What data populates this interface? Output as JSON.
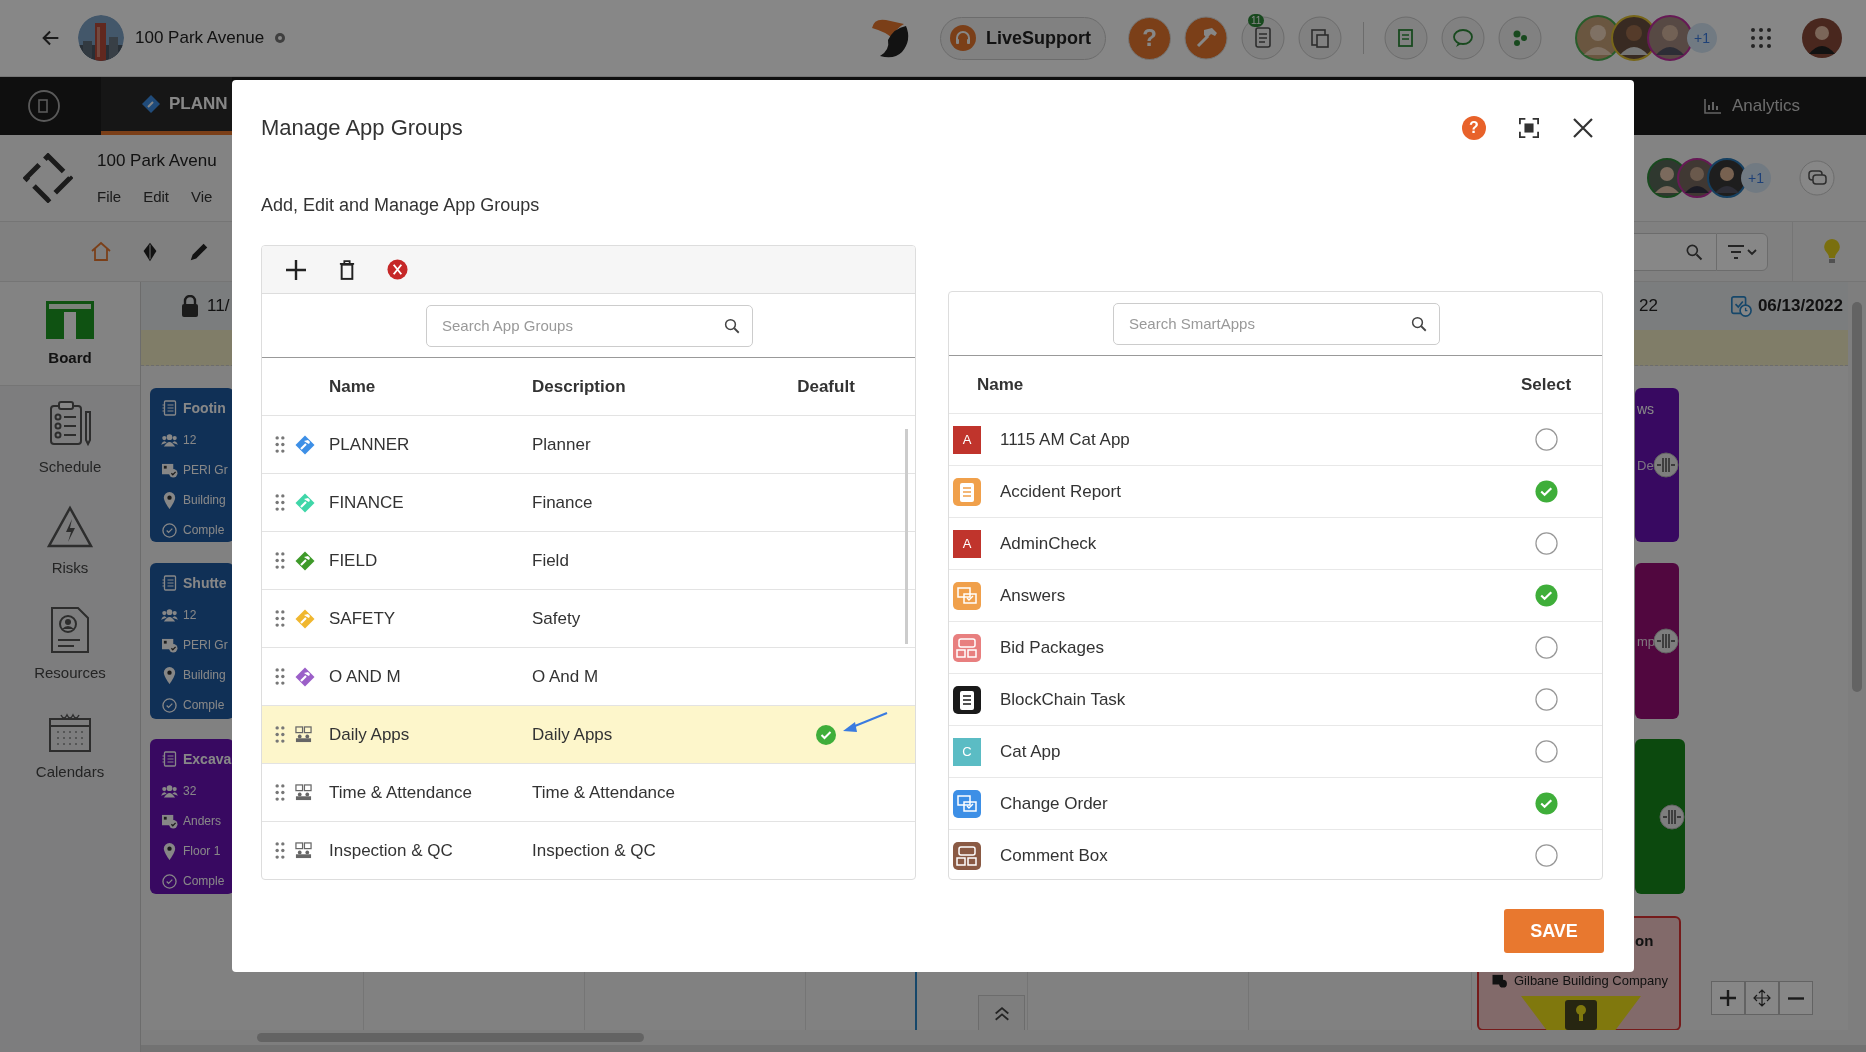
{
  "top_bar": {
    "project": "100 Park Avenue",
    "live_support": "LiveSupport",
    "help_label": "?",
    "notification_count": "11",
    "members_more": "+1"
  },
  "nav": {
    "tab": "PLANN",
    "analytics": "Analytics"
  },
  "project_header": {
    "title": "100 Park Avenu",
    "menu": [
      "File",
      "Edit",
      "Vie"
    ],
    "members_more": "+1"
  },
  "sidebar": {
    "items": [
      {
        "label": "Board",
        "selected": true
      },
      {
        "label": "Schedule",
        "selected": false
      },
      {
        "label": "Risks",
        "selected": false
      },
      {
        "label": "Resources",
        "selected": false
      },
      {
        "label": "Calendars",
        "selected": false
      }
    ]
  },
  "board": {
    "start_date": "11/",
    "end_date_part": "22",
    "end_date": "06/13/2022",
    "cards": [
      {
        "kind": "detail",
        "title": "Footin",
        "fields": [
          "12",
          "PERI Gr",
          "Building",
          "Comple"
        ]
      },
      {
        "kind": "detail",
        "title": "Shutte",
        "fields": [
          "12",
          "PERI Gr",
          "Building",
          "Comple"
        ]
      },
      {
        "kind": "detail",
        "title": "Excava",
        "fields": [
          "32",
          "Anders",
          "Floor 1",
          "Comple"
        ]
      },
      {
        "kind": "edge",
        "title": "ws",
        "detail": "De"
      },
      {
        "kind": "edge",
        "detail": "mp"
      },
      {
        "kind": "edge"
      },
      {
        "kind": "milestone",
        "title": "on",
        "company": "Gilbane Building Company"
      }
    ]
  },
  "dialog": {
    "title": "Manage App Groups",
    "help_label": "?",
    "subtitle": "Add, Edit and Manage App Groups",
    "groups": {
      "search": {
        "placeholder": "Search App Groups"
      },
      "columns": [
        "Name",
        "Description",
        "Deafult"
      ],
      "rows": [
        {
          "name": "PLANNER",
          "description": "Planner",
          "kind": "tag",
          "color": "#3d8fe6",
          "default": false,
          "selected": false
        },
        {
          "name": "FINANCE",
          "description": "Finance",
          "kind": "tag",
          "color": "#3fd6a8",
          "default": false,
          "selected": false
        },
        {
          "name": "FIELD",
          "description": "Field",
          "kind": "tag",
          "color": "#3e9a2a",
          "default": false,
          "selected": false
        },
        {
          "name": "SAFETY",
          "description": "Safety",
          "kind": "tag",
          "color": "#f0b72f",
          "default": false,
          "selected": false
        },
        {
          "name": "O AND M",
          "description": "O And M",
          "kind": "tag",
          "color": "#9b5fc8",
          "default": false,
          "selected": false
        },
        {
          "name": "Daily Apps",
          "description": "Daily Apps",
          "kind": "group",
          "default": true,
          "selected": true
        },
        {
          "name": "Time & Attendance",
          "description": "Time & Attendance",
          "kind": "group",
          "default": false,
          "selected": false
        },
        {
          "name": "Inspection & QC",
          "description": "Inspection & QC",
          "kind": "group",
          "default": false,
          "selected": false
        }
      ]
    },
    "smart_apps": {
      "search": {
        "placeholder": "Search SmartApps"
      },
      "columns": [
        "Name",
        "Select"
      ],
      "rows": [
        {
          "name": "1115 AM Cat App",
          "kind": "letter",
          "letter": "A",
          "color": "#c0342c",
          "selected": false
        },
        {
          "name": "Accident Report",
          "color": "#f0a04b",
          "selected": true
        },
        {
          "name": "AdminCheck",
          "kind": "letter",
          "letter": "A",
          "color": "#c0342c",
          "selected": false
        },
        {
          "name": "Answers",
          "color": "#f0a04b",
          "selected": true
        },
        {
          "name": "Bid Packages",
          "color": "#e87f7f",
          "selected": false
        },
        {
          "name": "BlockChain Task",
          "color": "#1a1a1a",
          "selected": false
        },
        {
          "name": "Cat App",
          "kind": "letter",
          "letter": "C",
          "color": "#5bbcc4",
          "selected": false
        },
        {
          "name": "Change Order",
          "color": "#3d8fe6",
          "selected": true
        },
        {
          "name": "Comment Box",
          "color": "#8a5a44",
          "selected": false
        }
      ]
    },
    "save": "SAVE"
  }
}
